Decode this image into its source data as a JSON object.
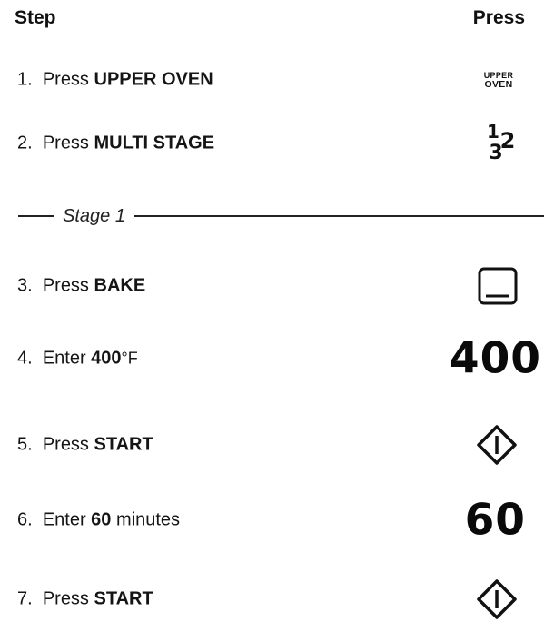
{
  "header": {
    "step": "Step",
    "press": "Press"
  },
  "steps": [
    {
      "num": "1.",
      "pre": "Press ",
      "bold": "UPPER OVEN",
      "post": ""
    },
    {
      "num": "2.",
      "pre": "Press ",
      "bold": "MULTI STAGE",
      "post": ""
    },
    {
      "num": "3.",
      "pre": "Press ",
      "bold": "BAKE",
      "post": ""
    },
    {
      "num": "4.",
      "pre": "Enter ",
      "bold": "400",
      "post": "°F"
    },
    {
      "num": "5.",
      "pre": "Press ",
      "bold": "START",
      "post": ""
    },
    {
      "num": "6.",
      "pre": "Enter ",
      "bold": "60",
      "post": " minutes"
    },
    {
      "num": "7.",
      "pre": "Press ",
      "bold": "START",
      "post": ""
    }
  ],
  "stage_label": "Stage 1",
  "keys": {
    "upper_oven_top": "UPPER",
    "upper_oven_bottom": "OVEN",
    "multi_stage_1": "1",
    "multi_stage_2": "2",
    "multi_stage_3": "3",
    "bake_icon": "bake-icon",
    "start_icon": "start-icon",
    "temp_display": "400",
    "time_display": "60"
  }
}
